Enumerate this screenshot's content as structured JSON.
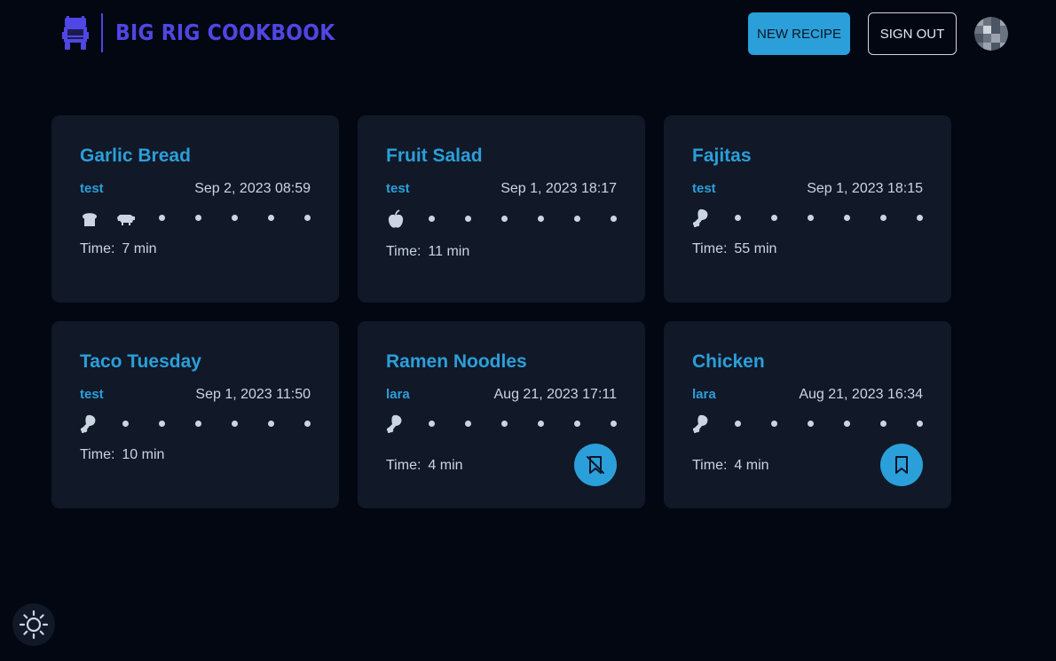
{
  "app": {
    "brand": "BIG RIG COOKBOOK",
    "colors": {
      "background": "#030712",
      "card": "#111827",
      "accent": "#2b9fd9",
      "brand": "#4f46e5",
      "text": "#cbd5e1"
    }
  },
  "header": {
    "logo_icon": "truck-icon",
    "new_recipe_label": "NEW RECIPE",
    "sign_out_label": "SIGN OUT",
    "avatar_icon": "user-avatar"
  },
  "recipes": [
    {
      "title": "Garlic Bread",
      "author": "test",
      "date": "Sep 2, 2023 08:59",
      "icons": [
        "bread-icon",
        "cow-icon"
      ],
      "time_label": "Time:",
      "time_value": "7 min",
      "bookmark": null
    },
    {
      "title": "Fruit Salad",
      "author": "test",
      "date": "Sep 1, 2023 18:17",
      "icons": [
        "apple-icon"
      ],
      "time_label": "Time:",
      "time_value": "11 min",
      "bookmark": null
    },
    {
      "title": "Fajitas",
      "author": "test",
      "date": "Sep 1, 2023 18:15",
      "icons": [
        "drumstick-icon"
      ],
      "time_label": "Time:",
      "time_value": "55 min",
      "bookmark": null
    },
    {
      "title": "Taco Tuesday",
      "author": "test",
      "date": "Sep 1, 2023 11:50",
      "icons": [
        "drumstick-icon"
      ],
      "time_label": "Time:",
      "time_value": "10 min",
      "bookmark": null
    },
    {
      "title": "Ramen Noodles",
      "author": "lara",
      "date": "Aug 21, 2023 17:11",
      "icons": [
        "drumstick-icon"
      ],
      "time_label": "Time:",
      "time_value": "4 min",
      "bookmark": "bookmark-off-icon"
    },
    {
      "title": "Chicken",
      "author": "lara",
      "date": "Aug 21, 2023 16:34",
      "icons": [
        "drumstick-icon"
      ],
      "time_label": "Time:",
      "time_value": "4 min",
      "bookmark": "bookmark-icon"
    }
  ],
  "theme_toggle_icon": "sun-icon"
}
